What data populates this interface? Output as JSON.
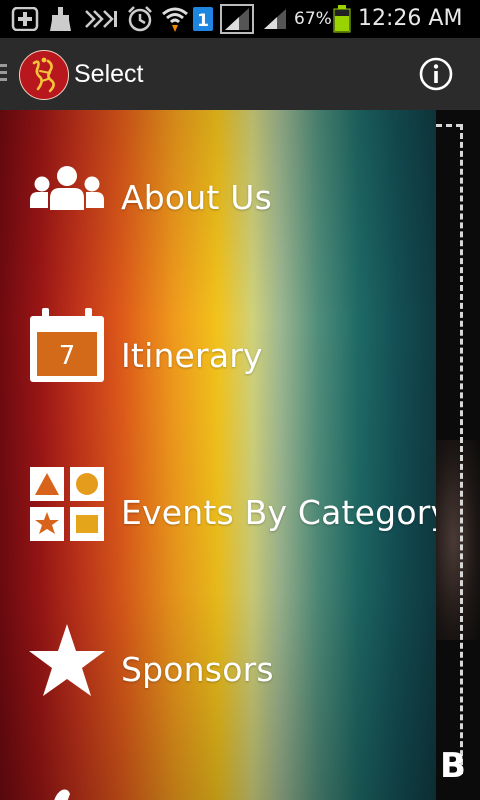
{
  "status_bar": {
    "icons": [
      "add-icon",
      "cleaner-icon",
      "no-signal-icon",
      "alarm-icon",
      "wifi-icon",
      "sim-1-icon",
      "signal-strength-icon",
      "signal-strength-icon",
      "battery-icon"
    ],
    "battery_percent": "67%",
    "time": "12:26 AM"
  },
  "action_bar": {
    "title": "Select",
    "info_icon": "info-icon",
    "logo_color": "#b8181d"
  },
  "menu": {
    "items": [
      {
        "label": "About Us",
        "icon": "people-icon"
      },
      {
        "label": "Itinerary",
        "icon": "calendar-icon",
        "icon_text": "7"
      },
      {
        "label": "Events By Category",
        "icon": "shapes-category-icon"
      },
      {
        "label": "Sponsors",
        "icon": "star-icon"
      }
    ]
  },
  "content_peek": {
    "logo_text": "B"
  }
}
